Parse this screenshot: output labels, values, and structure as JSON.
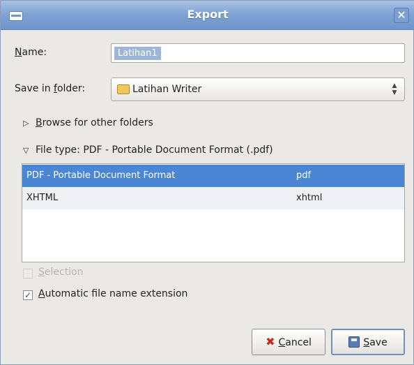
{
  "window": {
    "title": "Export",
    "close_glyph": "✕"
  },
  "form": {
    "name_label_prefix": "N",
    "name_label_rest": "ame:",
    "name_value": "Latihan1",
    "folder_label_prefix": "Save in ",
    "folder_label_accel": "f",
    "folder_label_rest": "older:",
    "folder_value": "Latihan Writer"
  },
  "browse": {
    "accel": "B",
    "rest": "rowse for other folders",
    "icon": "triangle-right-icon"
  },
  "file_type": {
    "label": "File type: PDF - Portable Document Format (.pdf)",
    "icon": "triangle-down-icon"
  },
  "file_types": [
    {
      "name": "PDF - Portable Document Format",
      "ext": "pdf",
      "selected": true
    },
    {
      "name": "XHTML",
      "ext": "xhtml",
      "selected": false
    }
  ],
  "options": {
    "selection_accel": "S",
    "selection_rest": "election",
    "selection_checked": false,
    "auto_ext_accel": "A",
    "auto_ext_rest": "utomatic file name extension",
    "auto_ext_checked": true
  },
  "buttons": {
    "cancel_accel": "C",
    "cancel_rest": "ancel",
    "save_accel": "S",
    "save_rest": "ave"
  },
  "colors": {
    "titlebar": "#7ea2d3",
    "selected_row": "#4a86d4",
    "cancel_icon": "#c8281e"
  }
}
